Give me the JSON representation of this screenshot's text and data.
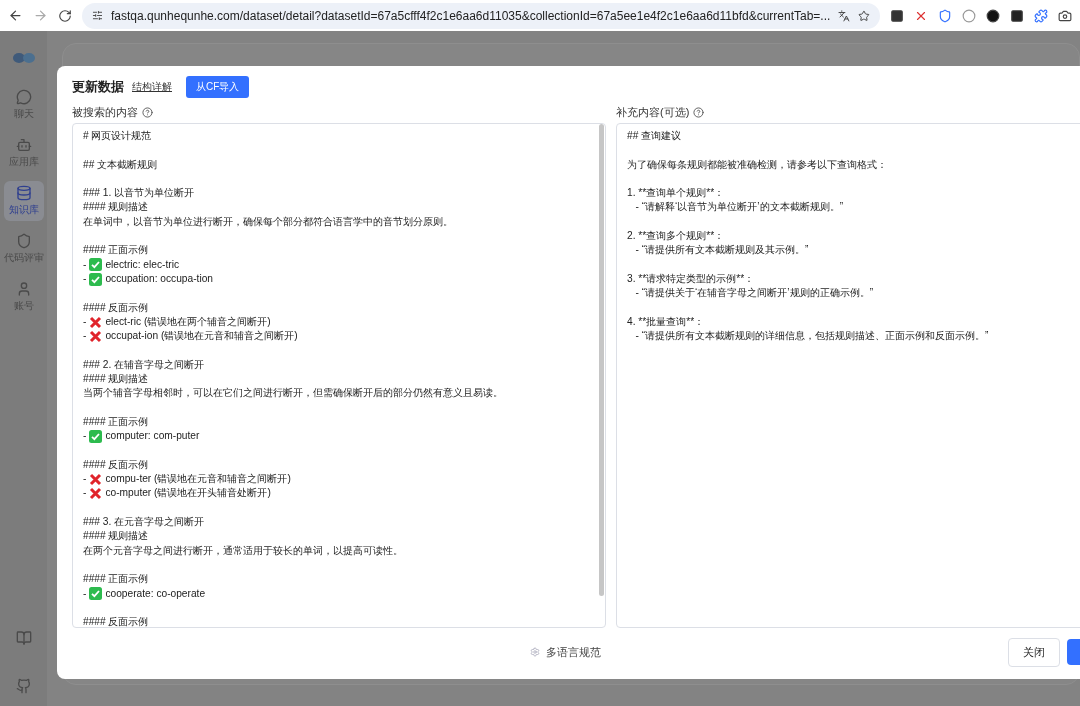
{
  "browser": {
    "url": "fastqa.qunhequnhe.com/dataset/detail?datasetId=67a5cfff4f2c1e6aa6d11035&collectionId=67a5ee1e4f2c1e6aa6d11bfd&currentTab=..."
  },
  "sidebar": {
    "items": [
      {
        "label": "聊天",
        "selected": false
      },
      {
        "label": "应用库",
        "selected": false
      },
      {
        "label": "知识库",
        "selected": true
      },
      {
        "label": "代码评审",
        "selected": false
      },
      {
        "label": "账号",
        "selected": false
      }
    ]
  },
  "dialog": {
    "title": "更新数据",
    "link": "结构详解",
    "import_button": "从CF导入",
    "panels": [
      {
        "label": "被搜索的内容",
        "lines": [
          {
            "kind": "plain",
            "text": "# 网页设计规范"
          },
          {
            "kind": "blank"
          },
          {
            "kind": "plain",
            "text": "## 文本截断规则"
          },
          {
            "kind": "blank"
          },
          {
            "kind": "plain",
            "text": "### 1. 以音节为单位断开"
          },
          {
            "kind": "plain",
            "text": "#### 规则描述"
          },
          {
            "kind": "plain",
            "text": "在单词中，以音节为单位进行断开，确保每个部分都符合语言学中的音节划分原则。"
          },
          {
            "kind": "blank"
          },
          {
            "kind": "plain",
            "text": "#### 正面示例"
          },
          {
            "kind": "good",
            "bullet": "-",
            "text": "electric: elec-tric"
          },
          {
            "kind": "good",
            "bullet": "-",
            "text": "occupation: occupa-tion"
          },
          {
            "kind": "blank"
          },
          {
            "kind": "plain",
            "text": "#### 反面示例"
          },
          {
            "kind": "bad",
            "bullet": "-",
            "text": "elect-ric (错误地在两个辅音之间断开)"
          },
          {
            "kind": "bad",
            "bullet": "-",
            "text": "occupat-ion (错误地在元音和辅音之间断开)"
          },
          {
            "kind": "blank"
          },
          {
            "kind": "plain",
            "text": "### 2. 在辅音字母之间断开"
          },
          {
            "kind": "plain",
            "text": "#### 规则描述"
          },
          {
            "kind": "plain",
            "text": "当两个辅音字母相邻时，可以在它们之间进行断开，但需确保断开后的部分仍然有意义且易读。"
          },
          {
            "kind": "blank"
          },
          {
            "kind": "plain",
            "text": "#### 正面示例"
          },
          {
            "kind": "good",
            "bullet": "-",
            "text": "computer: com-puter"
          },
          {
            "kind": "blank"
          },
          {
            "kind": "plain",
            "text": "#### 反面示例"
          },
          {
            "kind": "bad",
            "bullet": "-",
            "text": "compu-ter (错误地在元音和辅音之间断开)"
          },
          {
            "kind": "bad",
            "bullet": "-",
            "text": "co-mputer (错误地在开头辅音处断开)"
          },
          {
            "kind": "blank"
          },
          {
            "kind": "plain",
            "text": "### 3. 在元音字母之间断开"
          },
          {
            "kind": "plain",
            "text": "#### 规则描述"
          },
          {
            "kind": "plain",
            "text": "在两个元音字母之间进行断开，通常适用于较长的单词，以提高可读性。"
          },
          {
            "kind": "blank"
          },
          {
            "kind": "plain",
            "text": "#### 正面示例"
          },
          {
            "kind": "good",
            "bullet": "-",
            "text": "cooperate: co-operate"
          },
          {
            "kind": "blank"
          },
          {
            "kind": "plain",
            "text": "#### 反面示例"
          }
        ]
      },
      {
        "label": "补充内容(可选)",
        "lines": [
          {
            "kind": "plain",
            "text": "## 查询建议"
          },
          {
            "kind": "blank"
          },
          {
            "kind": "plain",
            "text": "为了确保每条规则都能被准确检测，请参考以下查询格式："
          },
          {
            "kind": "blank"
          },
          {
            "kind": "plain",
            "text": "1. **查询单个规则**："
          },
          {
            "kind": "plain",
            "text": "   - “请解释‘以音节为单位断开’的文本截断规则。”"
          },
          {
            "kind": "blank"
          },
          {
            "kind": "plain",
            "text": "2. **查询多个规则**："
          },
          {
            "kind": "plain",
            "text": "   - “请提供所有文本截断规则及其示例。”"
          },
          {
            "kind": "blank"
          },
          {
            "kind": "plain",
            "text": "3. **请求特定类型的示例**："
          },
          {
            "kind": "plain",
            "text": "   - “请提供关于‘在辅音字母之间断开’规则的正确示例。”"
          },
          {
            "kind": "blank"
          },
          {
            "kind": "plain",
            "text": "4. **批量查询**："
          },
          {
            "kind": "plain",
            "text": "   - “请提供所有文本截断规则的详细信息，包括规则描述、正面示例和反面示例。”"
          }
        ]
      }
    ],
    "footer": {
      "collection": "多语言规范",
      "close_button": "关闭"
    }
  }
}
